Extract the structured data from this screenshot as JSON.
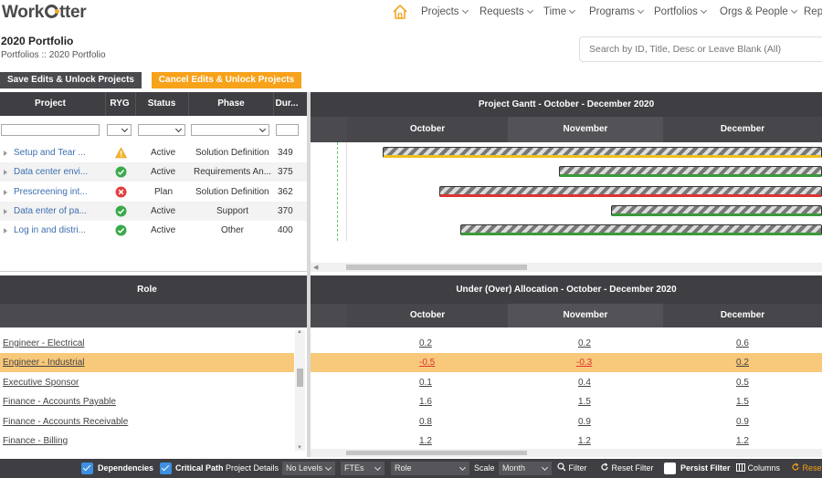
{
  "app": {
    "logo_text_pre": "Work",
    "logo_text_post": "tter"
  },
  "nav": {
    "items": [
      "Projects",
      "Requests",
      "Time",
      "Programs",
      "Portfolios",
      "Orgs & People",
      "Rep"
    ]
  },
  "page": {
    "title": "2020 Portfolio",
    "breadcrumb": "Portfolios :: 2020 Portfolio",
    "search_placeholder": "Search by ID, Title, Desc or Leave Blank (All)"
  },
  "buttons": {
    "save": "Save Edits & Unlock Projects",
    "cancel": "Cancel Edits & Unlock Projects"
  },
  "project_grid": {
    "columns": [
      "Project",
      "RYG",
      "Status",
      "Phase",
      "Dur..."
    ],
    "rows": [
      {
        "project": "Setup and Tear ...",
        "ryg": "warning",
        "status": "Active",
        "phase": "Solution Definition",
        "dur": "349"
      },
      {
        "project": "Data center envi...",
        "ryg": "green",
        "status": "Active",
        "phase": "Requirements An...",
        "dur": "375"
      },
      {
        "project": "Prescreening int...",
        "ryg": "red",
        "status": "Plan",
        "phase": "Solution Definition",
        "dur": "362"
      },
      {
        "project": "Data enter of pa...",
        "ryg": "green",
        "status": "Active",
        "phase": "Support",
        "dur": "370"
      },
      {
        "project": "Log in and distri...",
        "ryg": "green",
        "status": "Active",
        "phase": "Other",
        "dur": "400"
      }
    ]
  },
  "gantt": {
    "title": "Project Gantt - October - December 2020",
    "months": [
      "October",
      "November",
      "December"
    ]
  },
  "roles": {
    "header": "Role",
    "items": [
      "Engineer - Electrical",
      "Engineer - Industrial",
      "Executive Sponsor",
      "Finance - Accounts Payable",
      "Finance - Accounts Receivable",
      "Finance - Billing"
    ]
  },
  "allocation": {
    "title": "Under (Over) Allocation - October - December 2020",
    "months": [
      "October",
      "November",
      "December"
    ],
    "rows": [
      [
        "0.2",
        "0.2",
        "0.6"
      ],
      [
        "-0.5",
        "-0.3",
        "0.2"
      ],
      [
        "0.1",
        "0.4",
        "0.5"
      ],
      [
        "1.6",
        "1.5",
        "1.5"
      ],
      [
        "0.8",
        "0.9",
        "0.9"
      ],
      [
        "1.2",
        "1.2",
        "1.2"
      ]
    ]
  },
  "toolbar": {
    "dependencies": "Dependencies",
    "critical_path": "Critical Path",
    "project_details": "Project Details",
    "levels": "No Levels",
    "units": "FTEs",
    "group": "Role",
    "scale_label": "Scale",
    "scale": "Month",
    "filter": "Filter",
    "reset_filter": "Reset Filter",
    "persist_filter": "Persist Filter",
    "columns": "Columns",
    "reset": "Reset"
  },
  "colors": {
    "accent": "#f7a21b",
    "header": "#3e3e43",
    "link": "#3d6fb0"
  }
}
